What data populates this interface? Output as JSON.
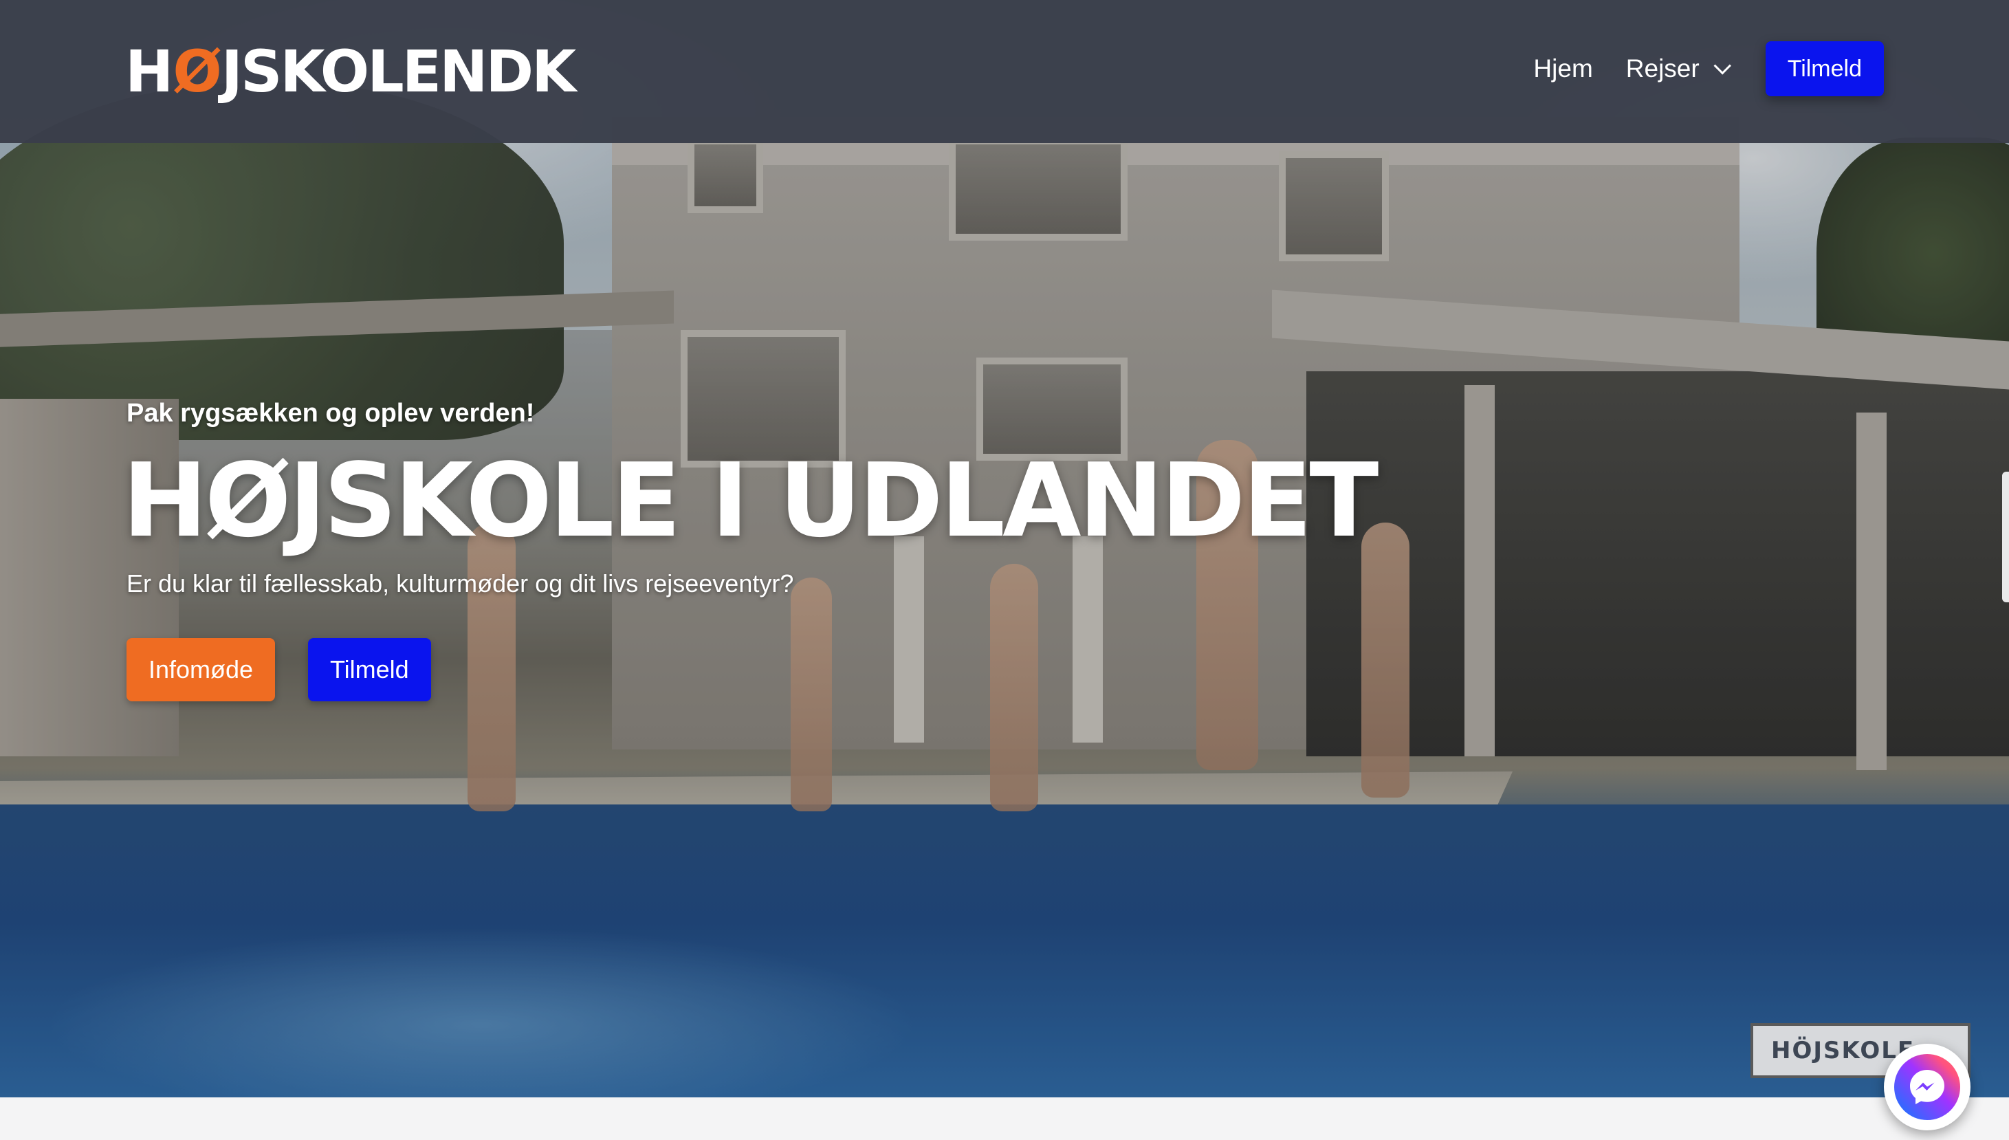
{
  "brand": {
    "logo_prefix": "H",
    "logo_o": "Ø",
    "logo_suffix": "JSKOLENDK",
    "primary_blue": "#0a14ee",
    "accent_orange": "#ef6c22",
    "header_bg": "#3a3e4a"
  },
  "nav": {
    "home": "Hjem",
    "trips": "Rejser",
    "trips_icon": "chevron-down-icon",
    "signup": "Tilmeld"
  },
  "hero": {
    "tagline": "Pak rygsækken og oplev verden!",
    "title": "HØJSKOLE I UDLANDET",
    "subtitle": "Er du klar til fællesskab, kulturmøder og dit livs rejseeventyr?",
    "info_button": "Infomøde",
    "signup_button": "Tilmeld",
    "video_watermark": "HÖJSKOLE"
  },
  "chat": {
    "icon": "messenger-icon"
  }
}
